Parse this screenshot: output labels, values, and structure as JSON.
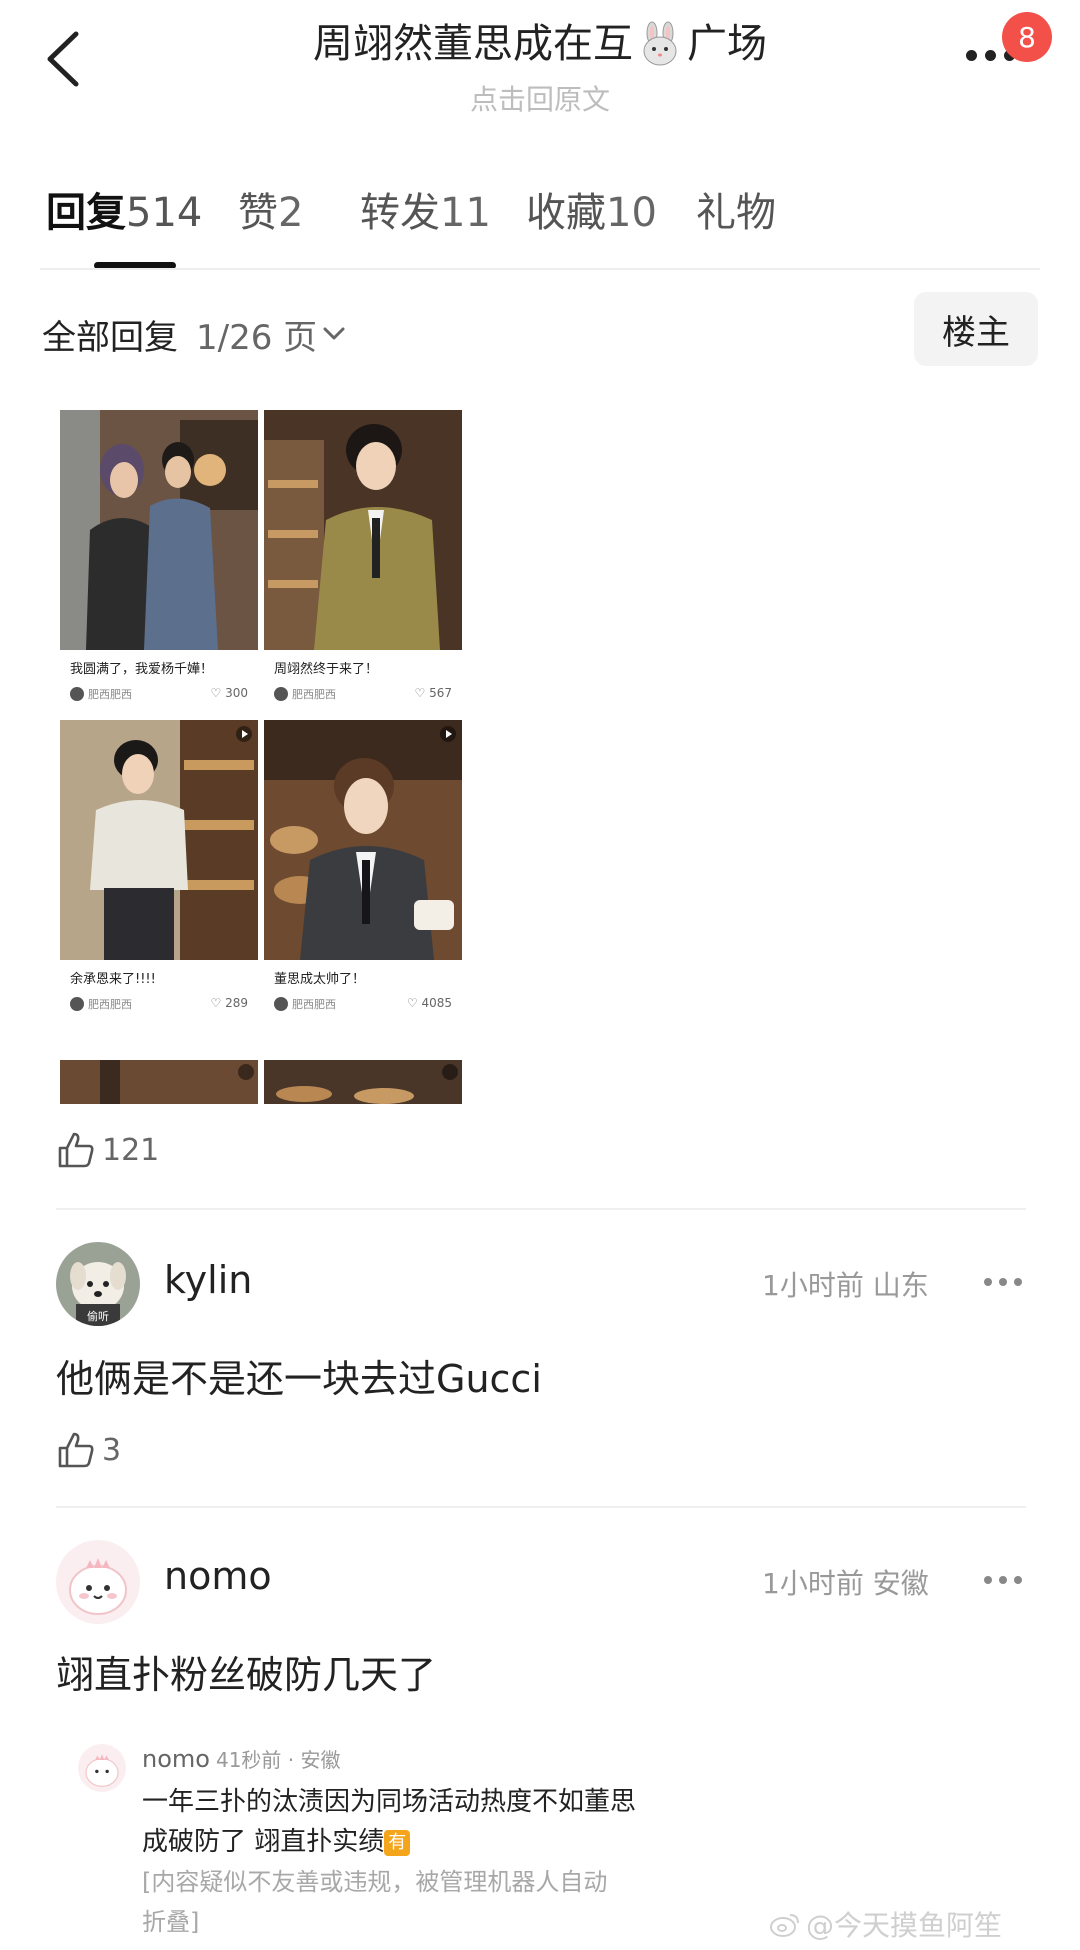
{
  "header": {
    "title_prefix": "周翊然董思成在互",
    "title_suffix": "广场",
    "subtitle": "点击回原文",
    "badge_count": "8",
    "icons": [
      "back-arrow-icon",
      "bunny-emoji-icon",
      "more-dots-icon"
    ]
  },
  "tabs": [
    {
      "label": "回复",
      "count": "514",
      "active": true
    },
    {
      "label": "赞",
      "count": "2",
      "active": false
    },
    {
      "label": "转发",
      "count": "11",
      "active": false
    },
    {
      "label": "收藏",
      "count": "10",
      "active": false
    },
    {
      "label": "礼物",
      "count": "",
      "active": false
    }
  ],
  "filter": {
    "title": "全部回复",
    "page": "1/26 页",
    "louzhu": "楼主"
  },
  "post_image": {
    "cards": [
      {
        "caption": "我圆满了，我爱杨千嬅！",
        "author": "肥西肥西",
        "likes": "300"
      },
      {
        "caption": "周翊然终于来了！",
        "author": "肥西肥西",
        "likes": "567"
      },
      {
        "caption": "余承恩来了!!!!",
        "author": "肥西肥西",
        "likes": "289"
      },
      {
        "caption": "董思成太帅了！",
        "author": "肥西肥西",
        "likes": "4085"
      }
    ]
  },
  "post": {
    "like_count": "121"
  },
  "comments": [
    {
      "username": "kylin",
      "avatar_label": "偷听",
      "time": "1小时前",
      "location": "山东",
      "text": "他俩是不是还一块去过Gucci",
      "likes": "3"
    },
    {
      "username": "nomo",
      "time": "1小时前",
      "location": "安徽",
      "text": "翊直扑粉丝破防几天了",
      "quote": {
        "username": "nomo",
        "time": "41秒前 · 安徽",
        "text_line1": "一年三扑的汰渍因为同场活动热度不如董思",
        "text_line2": "成破防了 翊直扑实绩",
        "tag": "有",
        "note_line1": "[内容疑似不友善或违规，被管理机器人自动",
        "note_line2": "折叠]"
      }
    }
  ],
  "watermark": "@今天摸鱼阿笙",
  "colors": {
    "badge": "#f4504a",
    "tag": "#f4a51c",
    "muted": "#999999"
  }
}
